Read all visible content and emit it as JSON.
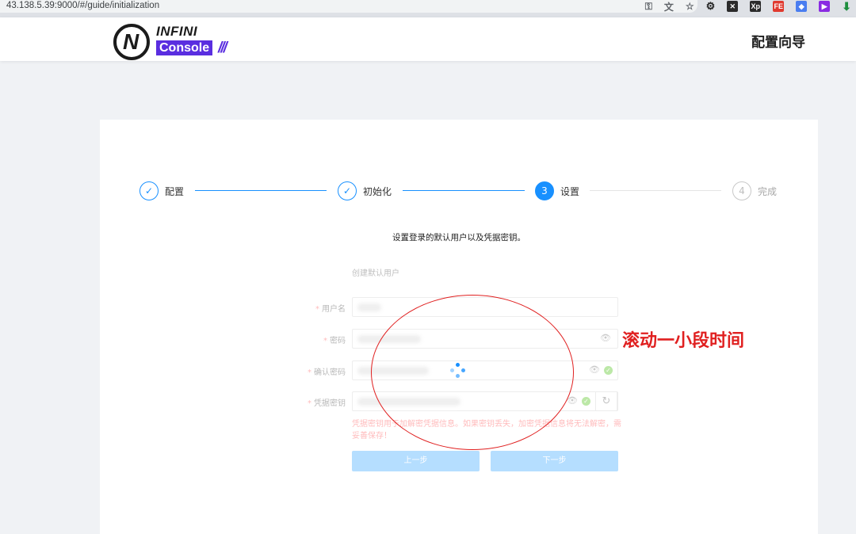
{
  "browser": {
    "url": "43.138.5.39:9000/#/guide/initialization",
    "icons": [
      "key-icon",
      "translate-icon",
      "star-icon",
      "extension-icon",
      "extension-icon",
      "extension-icon",
      "extension-icon",
      "extension-icon",
      "extension-icon",
      "download-icon"
    ]
  },
  "header": {
    "logo_top": "INFINI",
    "logo_bottom": "Console",
    "logo_slashes": "///",
    "title": "配置向导"
  },
  "steps": [
    {
      "label": "配置",
      "status": "finish"
    },
    {
      "label": "初始化",
      "status": "finish"
    },
    {
      "label": "设置",
      "number": "3",
      "status": "process"
    },
    {
      "label": "完成",
      "number": "4",
      "status": "wait"
    }
  ],
  "description": "设置登录的默认用户以及凭据密钥。",
  "form": {
    "section_title": "创建默认用户",
    "fields": [
      {
        "label": "用户名",
        "required": true
      },
      {
        "label": "密码",
        "required": true
      },
      {
        "label": "确认密码",
        "required": true
      },
      {
        "label": "凭据密钥",
        "required": true
      }
    ],
    "warning": "凭据密钥用于加解密凭据信息。如果密钥丢失，加密凭据信息将无法解密，需妥善保存！",
    "prev_button": "上一步",
    "next_button": "下一步"
  },
  "annotation": {
    "text": "滚动一小段时间",
    "color": "#e02020"
  },
  "colors": {
    "primary": "#1890ff",
    "brand": "#5a2ee0",
    "error": "#ff4d4f"
  }
}
